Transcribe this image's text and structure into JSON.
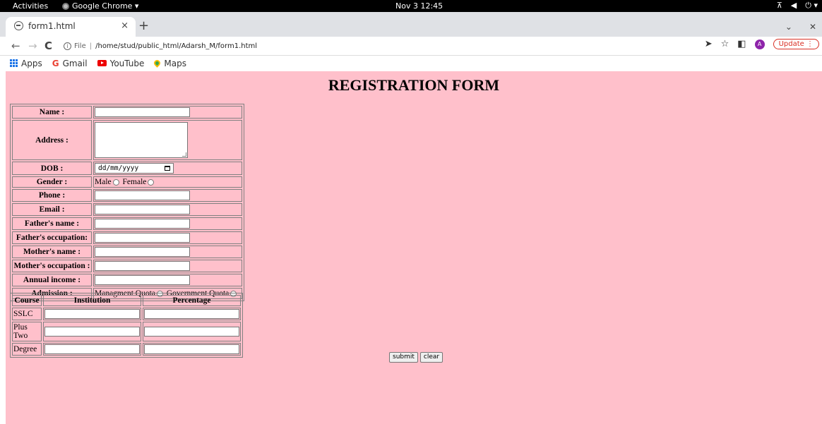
{
  "system_bar": {
    "activities": "Activities",
    "app_name": "Google Chrome ▾",
    "clock": "Nov 3  12:45"
  },
  "tab": {
    "title": "form1.html",
    "close": "×",
    "new_tab": "+"
  },
  "toolbar": {
    "url_protocol": "File",
    "url_path": "/home/stud/public_html/Adarsh_M/form1.html",
    "avatar_letter": "A",
    "update_label": "Update"
  },
  "bookmarks": [
    {
      "label": "Apps",
      "icon": "apps-grid-icon"
    },
    {
      "label": "Gmail",
      "icon": "google-g-icon"
    },
    {
      "label": "YouTube",
      "icon": "youtube-icon"
    },
    {
      "label": "Maps",
      "icon": "maps-pin-icon"
    }
  ],
  "page": {
    "heading": "REGISTRATION FORM",
    "background": "#ffc0cb",
    "fields": {
      "name": "Name :",
      "address": "Address :",
      "dob": "DOB :",
      "dob_placeholder": "dd/mm/yyyy",
      "gender": "Gender :",
      "gender_male": "Male",
      "gender_female": "Female",
      "phone": "Phone :",
      "email": "Email :",
      "father_name": "Father's name :",
      "father_occupation": "Father's occupation:",
      "mother_name": "Mother's name :",
      "mother_occupation": "Mother's occupation :",
      "annual_income": "Annual income :",
      "admission": "Admission :",
      "admission_management": "Managment Quota",
      "admission_government": "Government Quota"
    },
    "course_table": {
      "headers": [
        "Course",
        "Institution",
        "Percentage"
      ],
      "rows": [
        "SSLC",
        "Plus Two",
        "Degree"
      ]
    },
    "buttons": {
      "submit": "submit",
      "clear": "clear"
    }
  }
}
